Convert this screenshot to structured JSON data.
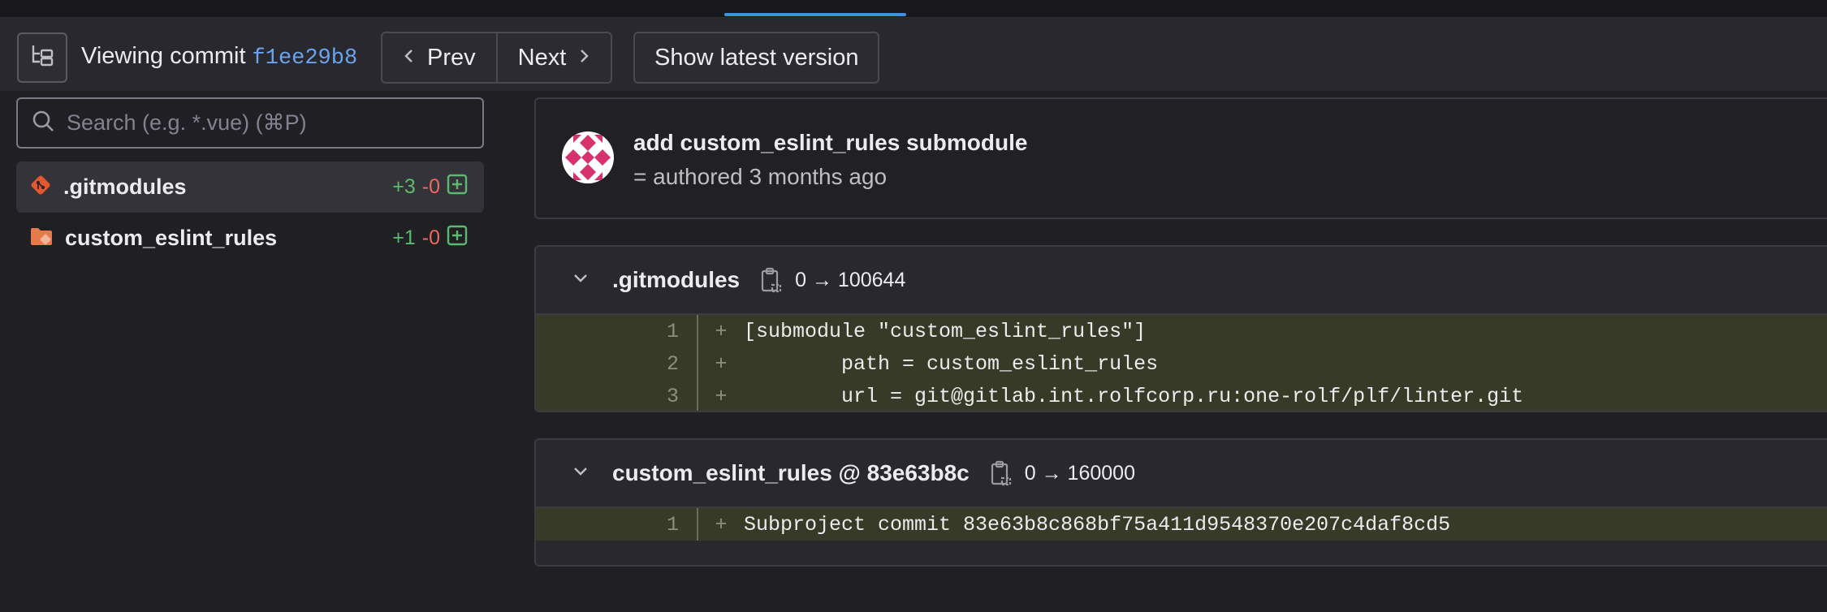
{
  "toolbar": {
    "viewing_label": "Viewing commit",
    "commit_sha": "f1ee29b8",
    "prev_label": "Prev",
    "next_label": "Next",
    "latest_label": "Show latest version"
  },
  "sidebar": {
    "search_placeholder": "Search (e.g. *.vue) (⌘P)",
    "files": [
      {
        "name": ".gitmodules",
        "added": "+3",
        "removed": "-0",
        "icon": "git-icon"
      },
      {
        "name": "custom_eslint_rules",
        "added": "+1",
        "removed": "-0",
        "icon": "folder-git-icon"
      }
    ]
  },
  "commit": {
    "title": "add custom_eslint_rules submodule",
    "meta": "= authored 3 months ago"
  },
  "diffs": [
    {
      "filename": ".gitmodules",
      "mode": "0 → 100644",
      "lines": [
        {
          "num": "1",
          "sign": "+",
          "code": "[submodule \"custom_eslint_rules\"]"
        },
        {
          "num": "2",
          "sign": "+",
          "code": "        path = custom_eslint_rules"
        },
        {
          "num": "3",
          "sign": "+",
          "code": "        url = git@gitlab.int.rolfcorp.ru:one-rolf/plf/linter.git"
        }
      ]
    },
    {
      "filename": "custom_eslint_rules @ 83e63b8c",
      "mode": "0 → 160000",
      "lines": [
        {
          "num": "1",
          "sign": "+",
          "code": "Subproject commit 83e63b8c868bf75a411d9548370e207c4daf8cd5"
        }
      ]
    }
  ],
  "colors": {
    "accent": "#428fdc",
    "sha": "#6ba3ec",
    "added": "#5bba6f",
    "removed": "#ec6a5e",
    "diff_added_bg": "#363a26",
    "avatar": "#d6336c"
  }
}
